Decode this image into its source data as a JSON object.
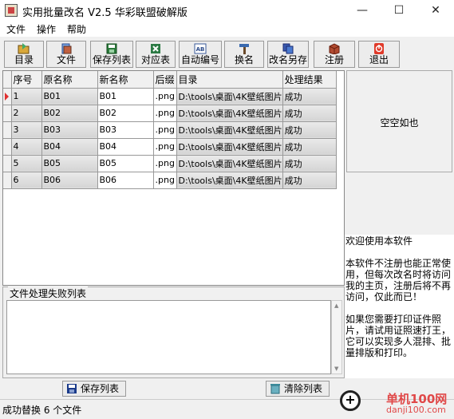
{
  "window": {
    "title": "实用批量改名 V2.5 华彩联盟破解版",
    "minimize": "—",
    "maximize": "☐",
    "close": "✕"
  },
  "menu": [
    "文件",
    "操作",
    "帮助"
  ],
  "toolbar": [
    "目录",
    "文件",
    "保存列表",
    "对应表",
    "自动编号",
    "换名",
    "改名另存",
    "注册",
    "退出"
  ],
  "grid": {
    "columns": [
      "序号",
      "原名称",
      "新名称",
      "后缀",
      "目录",
      "处理结果"
    ],
    "rows": [
      [
        "1",
        "B01",
        "B01",
        ".png",
        "D:\\tools\\桌面\\4K壁纸图片",
        "成功"
      ],
      [
        "2",
        "B02",
        "B02",
        ".png",
        "D:\\tools\\桌面\\4K壁纸图片",
        "成功"
      ],
      [
        "3",
        "B03",
        "B03",
        ".png",
        "D:\\tools\\桌面\\4K壁纸图片",
        "成功"
      ],
      [
        "4",
        "B04",
        "B04",
        ".png",
        "D:\\tools\\桌面\\4K壁纸图片",
        "成功"
      ],
      [
        "5",
        "B05",
        "B05",
        ".png",
        "D:\\tools\\桌面\\4K壁纸图片",
        "成功"
      ],
      [
        "6",
        "B06",
        "B06",
        ".png",
        "D:\\tools\\桌面\\4K壁纸图片",
        "成功"
      ]
    ]
  },
  "preview": {
    "empty_text": "空空如也"
  },
  "info": {
    "welcome": "欢迎使用本软件",
    "para1": "本软件不注册也能正常使用，但每次改名时将访问我的主页，注册后将不再访问，仅此而已！",
    "para2": "如果您需要打印证件照片，请试用证照速打王，它可以实现多人混排、批量排版和打印。"
  },
  "fail_list": {
    "title": "文件处理失败列表",
    "save_label": "保存列表",
    "clear_label": "清除列表"
  },
  "status": {
    "text": "成功替换 6 个文件"
  },
  "watermark": {
    "name": "单机100网",
    "url": "danji100.com"
  }
}
